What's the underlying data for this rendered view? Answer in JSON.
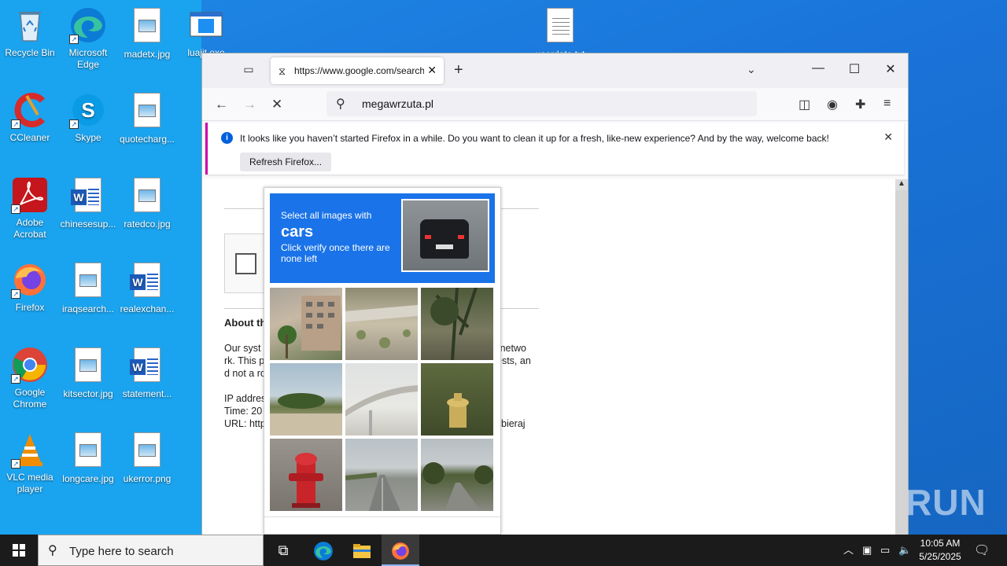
{
  "desktop": {
    "icons": [
      {
        "label": "Recycle Bin"
      },
      {
        "label": "Microsoft Edge"
      },
      {
        "label": "madetx.jpg"
      },
      {
        "label": "luajit.exe"
      },
      {
        "label": "userdata.txt"
      },
      {
        "label": "CCleaner"
      },
      {
        "label": "Skype"
      },
      {
        "label": "quotecharg..."
      },
      {
        "label": "Adobe Acrobat"
      },
      {
        "label": "chinesesup..."
      },
      {
        "label": "ratedco.jpg"
      },
      {
        "label": "Firefox"
      },
      {
        "label": "iraqsearch..."
      },
      {
        "label": "realexchan..."
      },
      {
        "label": "Google Chrome"
      },
      {
        "label": "kitsector.jpg"
      },
      {
        "label": "statement..."
      },
      {
        "label": "VLC media player"
      },
      {
        "label": "longcare.jpg"
      },
      {
        "label": "ukerror.png"
      }
    ]
  },
  "browser": {
    "tab_title": "https://www.google.com/search",
    "url_text": "megawrzuta.pl",
    "notification": {
      "message": "It looks like you haven’t started Firefox in a while. Do you want to clean it up for a fresh, like-new experience? And by the way, welcome back!",
      "button": "Refresh Firefox..."
    },
    "page": {
      "about_heading": "About th",
      "para_lines": [
        "Our syst",
        "rk. This p",
        "d not a ro"
      ],
      "para_right_lines": [
        "er netwo",
        "ests, an"
      ],
      "ip_label": "IP addres",
      "time_label": "Time: 20",
      "url_label": "URL: http",
      "url_tail": "bieraj"
    }
  },
  "captcha": {
    "line1": "Select all images with",
    "target": "cars",
    "line3": "Click verify once there are none left"
  },
  "taskbar": {
    "search_placeholder": "Type here to search",
    "time": "10:05 AM",
    "date": "5/25/2025"
  },
  "watermark": "ANY RUN"
}
